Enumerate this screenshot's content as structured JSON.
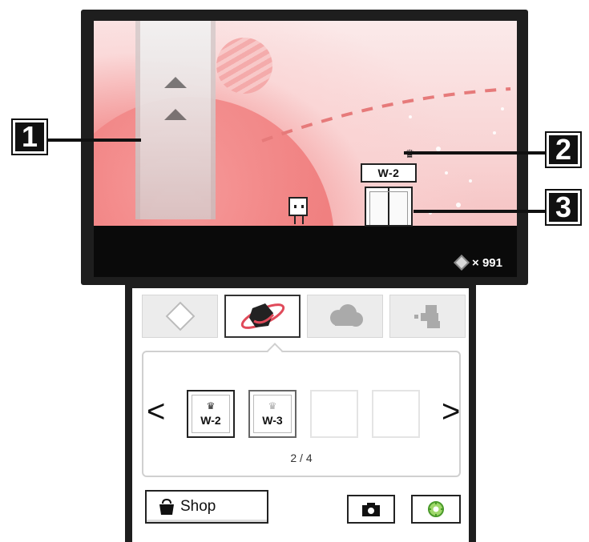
{
  "top_screen": {
    "door": {
      "crown": "♛",
      "label": "W-2"
    },
    "status": {
      "medal_count": "× 991"
    }
  },
  "callouts": [
    {
      "number": "1"
    },
    {
      "number": "2"
    },
    {
      "number": "3"
    }
  ],
  "bottom_screen": {
    "tabs": [
      {
        "icon": "diamond-icon"
      },
      {
        "icon": "planet-icon"
      },
      {
        "icon": "cloud-icon"
      },
      {
        "icon": "blocks-icon"
      }
    ],
    "level_select": {
      "prev_label": "<",
      "next_label": ">",
      "slots": [
        {
          "crown": "♛",
          "label": "W-2"
        },
        {
          "crown": "♛",
          "label": "W-3"
        },
        {
          "crown": "",
          "label": ""
        },
        {
          "crown": "",
          "label": ""
        }
      ],
      "page_indicator": "2 / 4"
    },
    "shop_label": "Shop"
  }
}
